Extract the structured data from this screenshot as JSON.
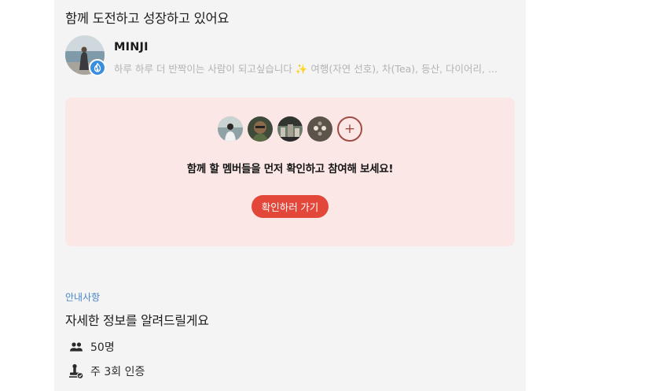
{
  "section": {
    "title": "함께 도전하고 성장하고 있어요"
  },
  "leader": {
    "name": "MINJI",
    "bio": "하루 하루 더 반짝이는 사람이 되고싶습니다 ✨ 여행(자연 선호), 차(Tea), 등산, 다이어리, ...",
    "badge_icon": "flame-icon",
    "badge_color": "#3a8ee0"
  },
  "members_card": {
    "message": "함께 할 멤버들을 먼저 확인하고 참여해 보세요!",
    "plus_label": "+",
    "cta_label": "확인하러 가기",
    "cta_color": "#e2473a",
    "background": "#fbe8e6"
  },
  "info": {
    "tag": "안내사항",
    "title": "자세한 정보를 알려드릴게요",
    "rows": [
      {
        "icon": "people-icon",
        "text": "50명"
      },
      {
        "icon": "stamp-check-icon",
        "text": "주 3회 인증"
      }
    ]
  },
  "colors": {
    "accent_blue": "#4a86c9",
    "panel_bg": "#f4f4f4"
  }
}
